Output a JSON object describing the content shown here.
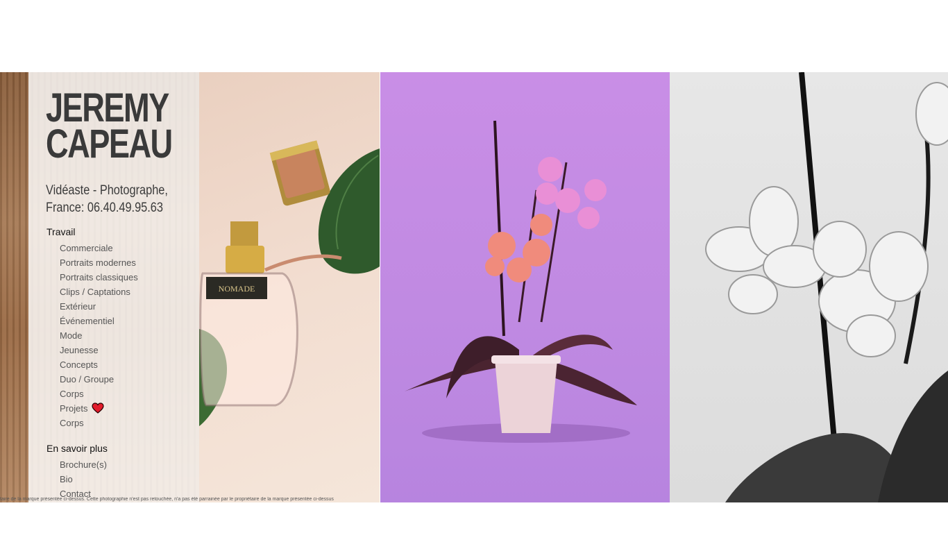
{
  "brand": {
    "line1": "JEREMY",
    "line2": "CAPEAU"
  },
  "tagline": {
    "line1": "Vidéaste - Photographe,",
    "line2": "France: 06.40.49.95.63"
  },
  "sections": {
    "travail": {
      "title": "Travail",
      "items": [
        "Commerciale",
        "Portraits modernes",
        "Portraits classiques",
        "Clips / Captations",
        "Extérieur",
        "Événementiel",
        "Mode",
        "Jeunesse",
        "Concepts",
        "Duo / Groupe",
        "Corps",
        "Projets",
        "Corps"
      ]
    },
    "en_savoir_plus": {
      "title": "En savoir plus",
      "items": [
        "Brochure(s)",
        "Bio",
        "Contact"
      ]
    }
  },
  "photos": {
    "perfume_label": "NOMADE"
  },
  "caption": "taire de la marque présentée ci-dessus. Cette photographie n'est pas retouchée, n'a pas été parrainée par le propriétaire de la marque présentée ci-dessus",
  "colors": {
    "text": "#3a3a3a",
    "purple_bg": "#c98ee6",
    "heart": "#e21b2b"
  }
}
